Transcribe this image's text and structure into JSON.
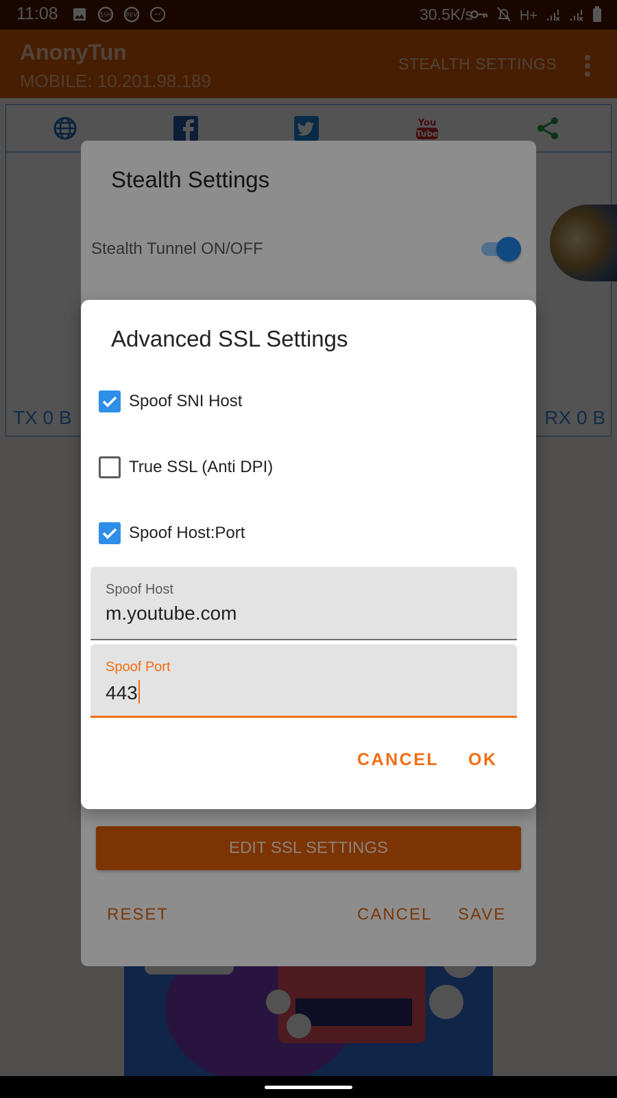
{
  "status_bar": {
    "time": "11:08",
    "net_speed": "30.5K/s",
    "left_icons": [
      "gallery-icon",
      "ssh-icon",
      "rev-icon",
      "messenger-icon"
    ],
    "right_icons": [
      "vpn-key-icon",
      "mute-icon",
      "h-plus-icon",
      "signal-x-icon",
      "signal-x-icon",
      "battery-icon"
    ]
  },
  "app_bar": {
    "title": "AnonyTun",
    "subtitle": "MOBILE: 10.201.98.189",
    "action": "STEALTH SETTINGS"
  },
  "background": {
    "tabs": [
      "globe-icon",
      "facebook-icon",
      "twitter-icon",
      "youtube-icon",
      "share-icon"
    ],
    "tx": "TX 0 B",
    "rx": "RX 0 B"
  },
  "stealth_dialog": {
    "title": "Stealth Settings",
    "toggle_label": "Stealth Tunnel ON/OFF",
    "toggle_on": true,
    "edit_button": "EDIT SSL SETTINGS",
    "reset": "RESET",
    "cancel": "CANCEL",
    "save": "SAVE"
  },
  "ssl_dialog": {
    "title": "Advanced SSL Settings",
    "options": [
      {
        "label": "Spoof SNI Host",
        "checked": true
      },
      {
        "label": "True SSL (Anti DPI)",
        "checked": false
      },
      {
        "label": "Spoof Host:Port",
        "checked": true
      }
    ],
    "host_field": {
      "label": "Spoof Host",
      "value": "m.youtube.com"
    },
    "port_field": {
      "label": "Spoof Port",
      "value": "443"
    },
    "cancel": "CANCEL",
    "ok": "OK"
  },
  "colors": {
    "status_bar": "#4e1302",
    "app_bar": "#d25a07",
    "accent": "#f26d14",
    "checkbox_on": "#2f8ee8"
  }
}
